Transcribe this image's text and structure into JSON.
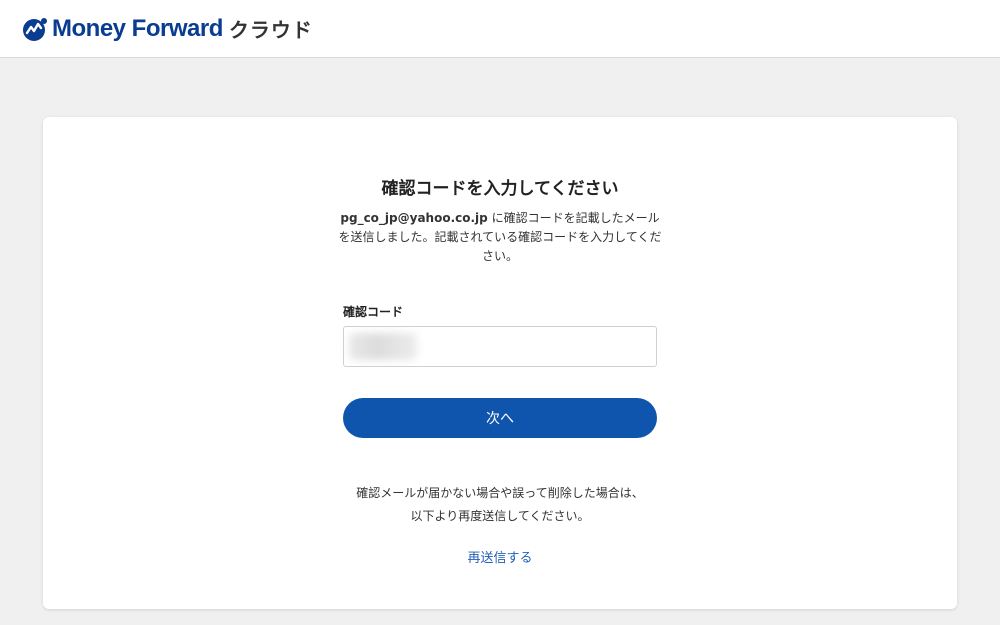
{
  "header": {
    "brand_name": "Money Forward",
    "brand_suffix": "クラウド",
    "brand_color": "#0a3d91"
  },
  "form": {
    "title": "確認コードを入力してください",
    "email": "pg_co_jp@yahoo.co.jp",
    "description": " に確認コードを記載したメールを送信しました。記載されている確認コードを入力してください。",
    "field_label": "確認コード",
    "code_value": "",
    "submit_label": "次へ",
    "submit_color": "#0f55ad",
    "note_line1": "確認メールが届かない場合や誤って削除した場合は、",
    "note_line2": "以下より再度送信してください。",
    "resend_label": "再送信する",
    "link_color": "#1f5fb6"
  },
  "icons": {
    "logo": "money-forward-logo-icon"
  }
}
